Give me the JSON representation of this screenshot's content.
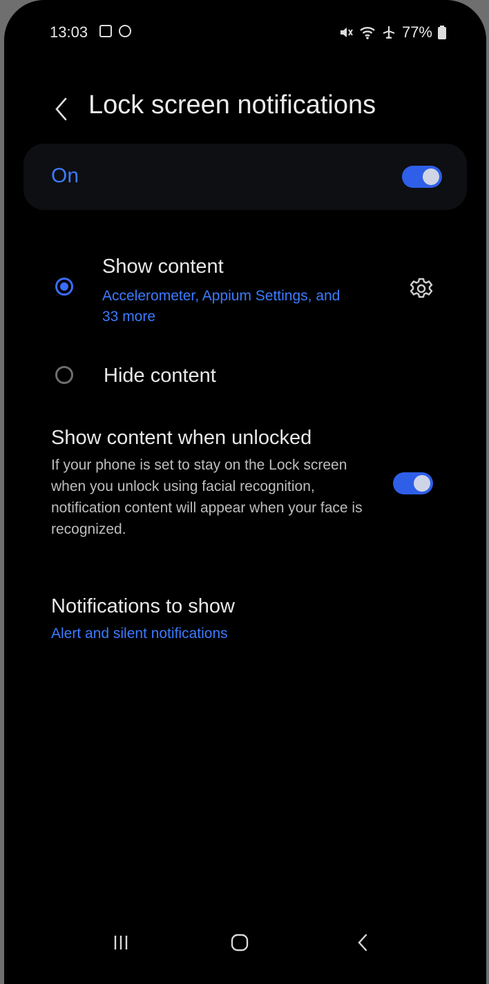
{
  "status_bar": {
    "time": "13:03",
    "left_icons": [
      "checkbox-notification-icon",
      "circle-app-icon"
    ],
    "right_icons": [
      "mute-icon",
      "wifi-icon",
      "airplane-icon"
    ],
    "battery": "77%"
  },
  "header": {
    "title": "Lock screen notifications",
    "back_icon": "chevron-left-icon"
  },
  "master_switch": {
    "label": "On",
    "state": true
  },
  "options": [
    {
      "title": "Show content",
      "subtitle": "Accelerometer, Appium Settings, and 33 more",
      "selected": true,
      "settings_icon": "gear-icon"
    },
    {
      "title": "Hide content",
      "selected": false
    }
  ],
  "show_when_unlocked": {
    "title": "Show content when unlocked",
    "description": "If your phone is set to stay on the Lock screen when you unlock using facial recognition, notification content will appear when your face is recognized.",
    "state": true
  },
  "notifications_to_show": {
    "title": "Notifications to show",
    "value": "Alert and silent notifications"
  },
  "nav_bar": {
    "recents_icon": "recents-icon",
    "home_icon": "home-icon",
    "back_icon": "back-icon"
  },
  "colors": {
    "background": "#000000",
    "accent": "#3c7bff",
    "toggle_on": "#2f5fe8",
    "text_primary": "#e8e8e8",
    "text_secondary": "#bdbdbd"
  }
}
